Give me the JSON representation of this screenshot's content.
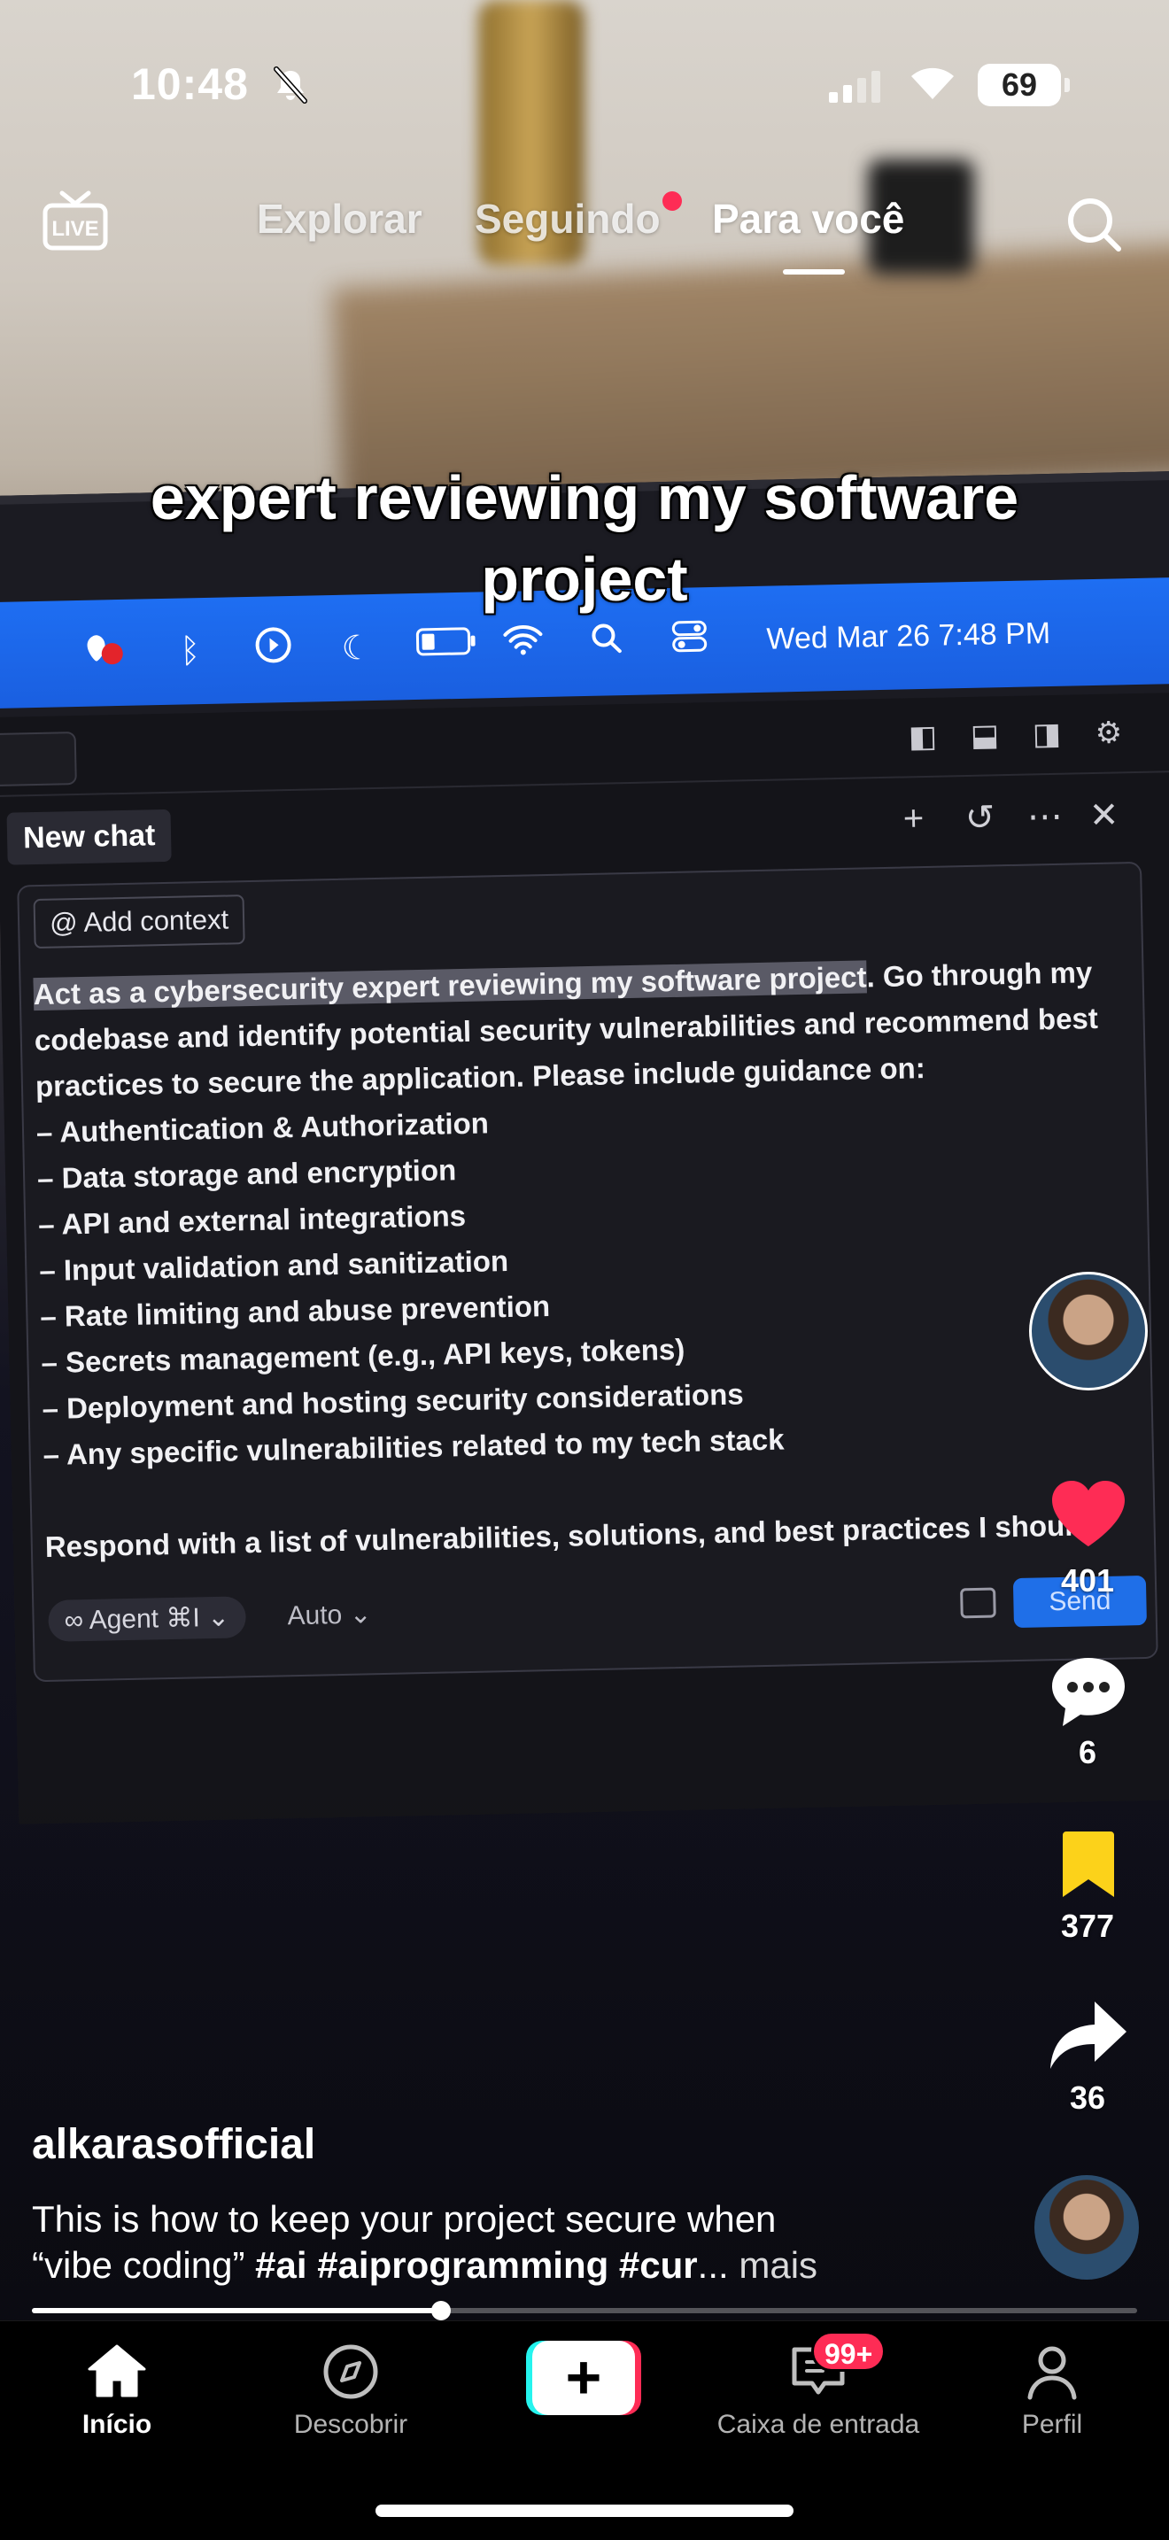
{
  "status_bar": {
    "time": "10:48",
    "battery": "69"
  },
  "top_nav": {
    "tabs": [
      "Explorar",
      "Seguindo",
      "Para você"
    ],
    "active": "Para você"
  },
  "caption": "expert reviewing my software project",
  "video": {
    "menubar_date": "Wed Mar 26  7:48 PM",
    "chat_tab": "New chat",
    "add_context": "@ Add context",
    "prompt": {
      "highlighted": "Act as a cybersecurity expert reviewing my software project",
      "line1_rest": ". Go through my",
      "lines": [
        "codebase and identify potential security vulnerabilities and recommend best",
        "practices to secure the application. Please include guidance on:",
        "– Authentication & Authorization",
        "– Data storage and encryption",
        "– API and external integrations",
        "– Input validation and sanitization",
        "– Rate limiting and abuse prevention",
        "– Secrets management (e.g., API keys, tokens)",
        "– Deployment and hosting security considerations",
        "– Any specific vulnerabilities related to my tech stack"
      ],
      "closing": "Respond with a list of vulnerabilities, solutions, and best practices I should"
    },
    "agent_label": "∞ Agent ⌘I ⌄",
    "auto_label": "Auto ⌄",
    "send_label": "Send"
  },
  "actions": {
    "likes": "401",
    "comments": "6",
    "saves": "377",
    "shares": "36"
  },
  "post": {
    "username": "alkarasofficial",
    "desc_line1": "This is how to keep your project secure when",
    "desc_quote": "“vibe coding”",
    "desc_tags": "#ai #aiprogramming #cur",
    "desc_ellipsis": "...",
    "desc_more": "mais"
  },
  "progress": 0.37,
  "tab_bar": {
    "home": "Início",
    "discover": "Descobrir",
    "inbox": "Caixa de entrada",
    "inbox_badge": "99+",
    "profile": "Perfil"
  },
  "colors": {
    "accent": "#fe2c55",
    "like": "#fe2c55",
    "save": "#fcd21a",
    "macos_menubar": "#1e6ef2"
  }
}
